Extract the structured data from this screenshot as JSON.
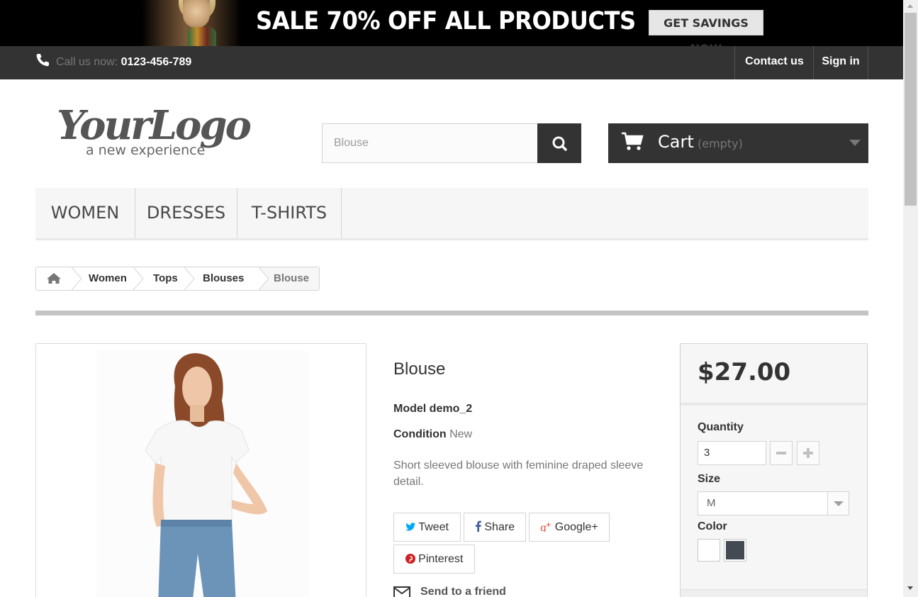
{
  "banner": {
    "headline": "SALE 70% OFF ALL PRODUCTS",
    "button_label": "GET SAVINGS NOW"
  },
  "topnav": {
    "call_prefix": "Call us now: ",
    "phone": "0123-456-789",
    "contact_label": "Contact us",
    "signin_label": "Sign in"
  },
  "header": {
    "logo_text": "YourLogo",
    "logo_tagline": "a new experience",
    "search_placeholder": "Blouse",
    "cart_label": "Cart",
    "cart_status": "(empty)"
  },
  "menu": {
    "items": [
      {
        "label": "WOMEN"
      },
      {
        "label": "DRESSES"
      },
      {
        "label": "T-SHIRTS"
      }
    ]
  },
  "breadcrumb": {
    "items": [
      {
        "label": "Women"
      },
      {
        "label": "Tops"
      },
      {
        "label": "Blouses"
      },
      {
        "label": "Blouse"
      }
    ]
  },
  "product": {
    "title": "Blouse",
    "model": "Model demo_2",
    "condition_label": "Condition",
    "condition_value": "New",
    "description": "Short sleeved blouse with feminine draped sleeve detail.",
    "social": {
      "tweet": "Tweet",
      "share": "Share",
      "gplus": "Google+",
      "pinterest": "Pinterest"
    },
    "send_to_friend": "Send to a friend"
  },
  "buybox": {
    "price": "$27.00",
    "quantity_label": "Quantity",
    "quantity_value": "3",
    "size_label": "Size",
    "size_value": "M",
    "color_label": "Color",
    "colors": [
      "#ffffff",
      "#434a54"
    ]
  },
  "colors": {
    "dark": "#333333",
    "twitter": "#00aaf0",
    "facebook": "#435f9f",
    "gplus": "#e04b34",
    "pinterest": "#ce1f21"
  }
}
